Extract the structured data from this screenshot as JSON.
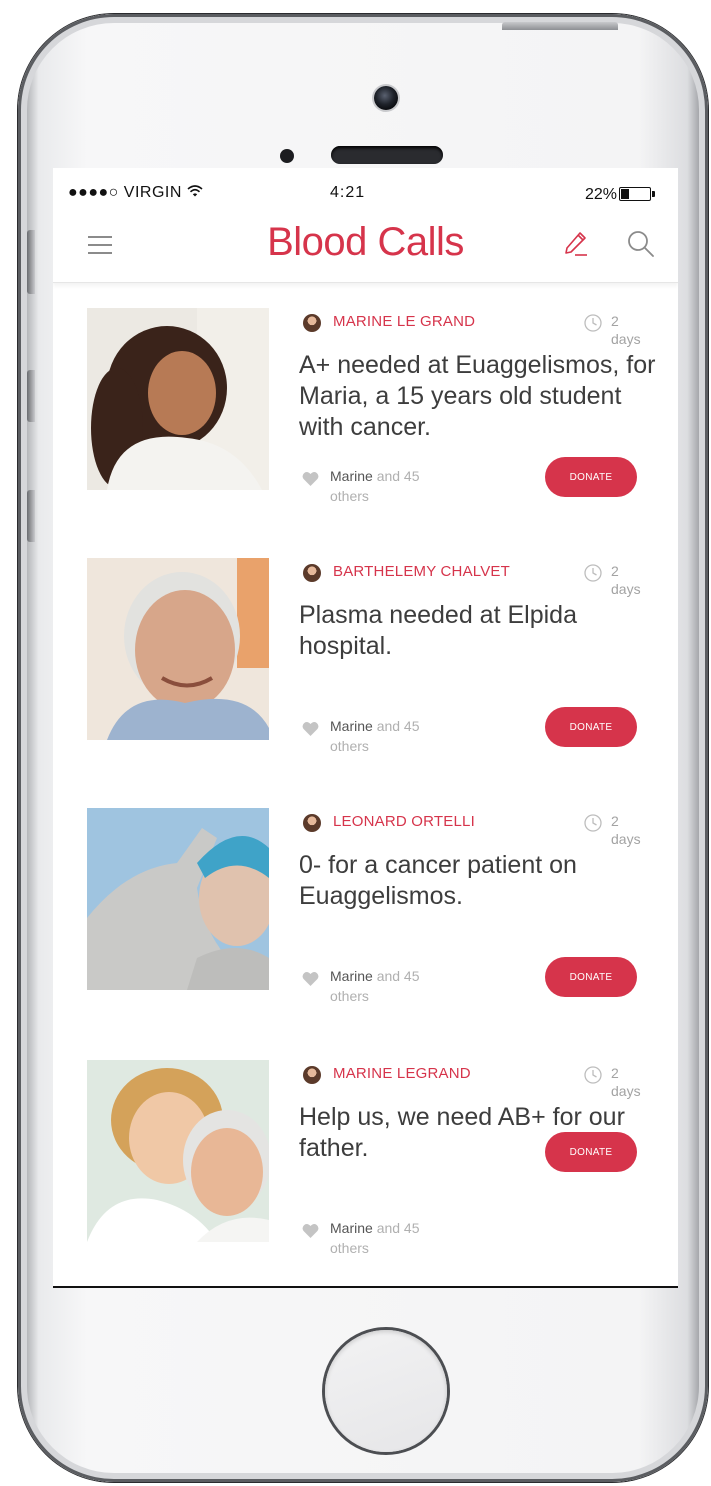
{
  "status_bar": {
    "signal": "●●●●○",
    "carrier": "VIRGIN",
    "time": "4:21",
    "battery": "22%",
    "battery_level": 0.22
  },
  "header": {
    "title": "Blood Calls",
    "menu_icon": "hamburger-menu-icon",
    "compose_icon": "pencil-icon",
    "search_icon": "search-icon"
  },
  "colors": {
    "accent": "#d6344b",
    "muted_text": "#a3a3a3",
    "body_text": "#3d3d3d"
  },
  "posts": [
    {
      "author": "MARINE LE GRAND",
      "age_number": "2",
      "age_unit": "days",
      "text": "A+ needed at Euaggelismos, for Maria, a 15 years old student with cancer.",
      "liker": "Marine",
      "likes_rest_1": "and 45",
      "likes_rest_2": "others",
      "donate_label": "DONATE"
    },
    {
      "author": "BARTHELEMY CHALVET",
      "age_number": "2",
      "age_unit": "days",
      "text": "Plasma needed at Elpida hospital.",
      "liker": "Marine",
      "likes_rest_1": "and 45",
      "likes_rest_2": "others",
      "donate_label": "DONATE"
    },
    {
      "author": "LEONARD ORTELLI",
      "age_number": "2",
      "age_unit": "days",
      "text": "0- for a cancer patient on Euaggelismos.",
      "liker": "Marine",
      "likes_rest_1": "and 45",
      "likes_rest_2": "others",
      "donate_label": "DONATE"
    },
    {
      "author": "MARINE LEGRAND",
      "age_number": "2",
      "age_unit": "days",
      "text": "Help us, we need AB+ for our father.",
      "liker": "Marine",
      "likes_rest_1": "and 45",
      "likes_rest_2": "others",
      "donate_label": "DONATE"
    }
  ]
}
